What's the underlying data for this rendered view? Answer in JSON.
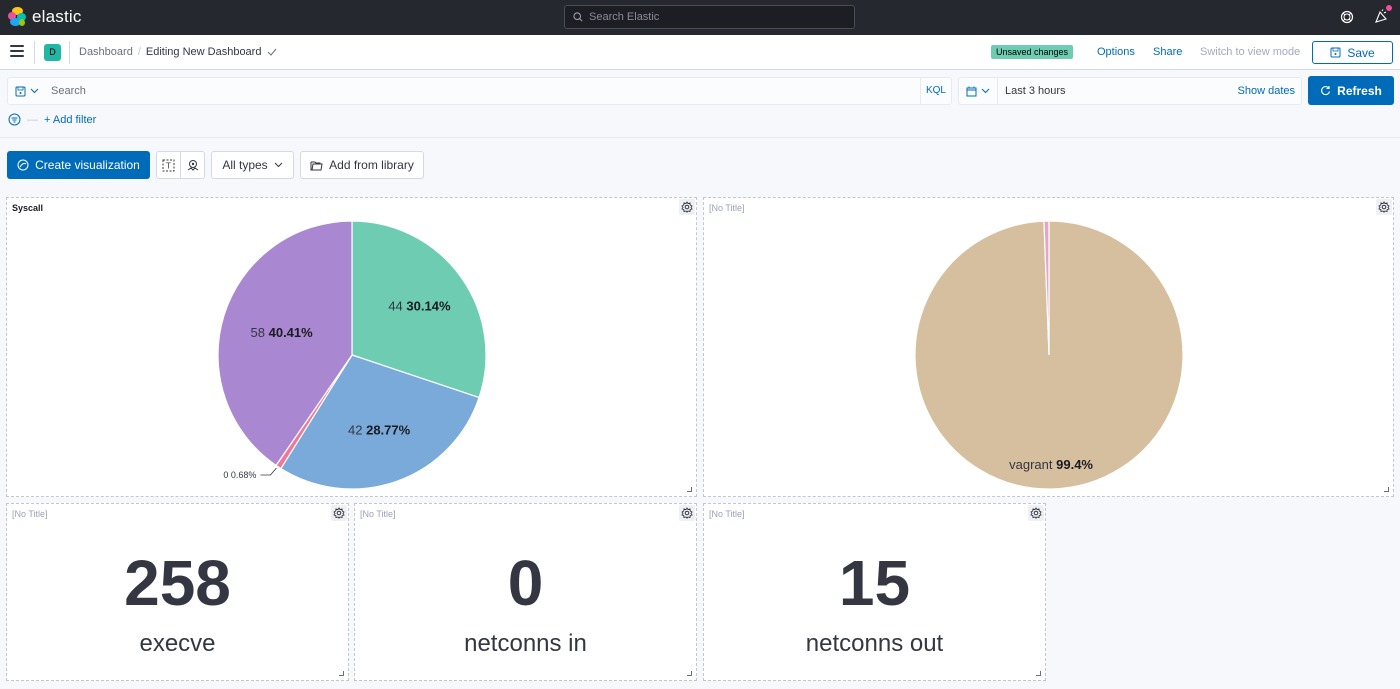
{
  "topbar": {
    "app_name": "elastic",
    "search_placeholder": "Search Elastic"
  },
  "appbar": {
    "space_initial": "D",
    "breadcrumbs": [
      {
        "label": "Dashboard"
      },
      {
        "label": "Editing New Dashboard"
      }
    ],
    "unsaved_badge": "Unsaved changes",
    "options_label": "Options",
    "share_label": "Share",
    "switch_mode_label": "Switch to view mode",
    "save_label": "Save"
  },
  "querybar": {
    "search_placeholder": "Search",
    "search_value": "",
    "language_label": "KQL",
    "time_range": "Last 3 hours",
    "show_dates_label": "Show dates",
    "refresh_label": "Refresh",
    "add_filter_label": "+ Add filter"
  },
  "toolbar": {
    "create_visualization_label": "Create visualization",
    "all_types_label": "All types",
    "add_from_library_label": "Add from library"
  },
  "panels": {
    "syscall": {
      "title": "Syscall",
      "chart_data": {
        "type": "pie",
        "title": "Syscall",
        "slices": [
          {
            "label": "",
            "count": 44,
            "percent": 30.14,
            "color": "#6dccb1"
          },
          {
            "label": "",
            "count": 42,
            "percent": 28.77,
            "color": "#79aad9"
          },
          {
            "label": "",
            "count": 0,
            "percent": 0.68,
            "color": "#ee789d"
          },
          {
            "label": "",
            "count": 58,
            "percent": 40.41,
            "color": "#a987d1"
          }
        ],
        "data_labels": [
          "44",
          "30.14%",
          "42",
          "28.77%",
          "0",
          "0.68%",
          "58",
          "40.41%"
        ]
      }
    },
    "user_pie": {
      "title": "[No Title]",
      "chart_data": {
        "type": "pie",
        "slices": [
          {
            "label": "vagrant",
            "percent": 99.4,
            "color": "#d6bf9f"
          },
          {
            "label": "",
            "percent": 0.6,
            "color": "#e4a6c7"
          }
        ],
        "data_labels": [
          "vagrant",
          "99.4%"
        ]
      }
    },
    "metrics": [
      {
        "title": "[No Title]",
        "value": "258",
        "label": "execve"
      },
      {
        "title": "[No Title]",
        "value": "0",
        "label": "netconns in"
      },
      {
        "title": "[No Title]",
        "value": "15",
        "label": "netconns out"
      }
    ]
  },
  "colors": {
    "primary": "#006bb8",
    "header_dark": "#25282f",
    "unsaved_badge": "#6dccb1"
  }
}
